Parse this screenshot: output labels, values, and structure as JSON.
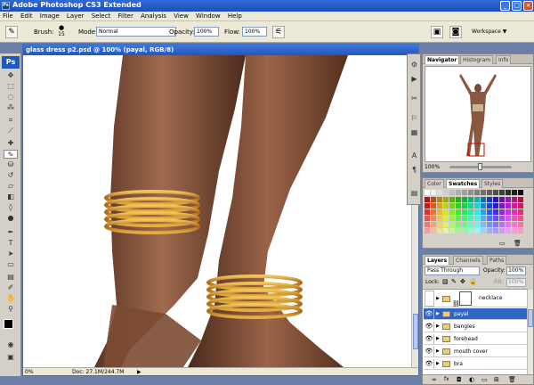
{
  "app": {
    "title": "Adobe Photoshop CS3 Extended",
    "logo": "Ps",
    "window_min": "_",
    "window_max": "□",
    "window_close": "×"
  },
  "menu": [
    "File",
    "Edit",
    "Image",
    "Layer",
    "Select",
    "Filter",
    "Analysis",
    "View",
    "Window",
    "Help"
  ],
  "options": {
    "brush_label": "Brush:",
    "brush_size": "15",
    "mode_label": "Mode:",
    "mode_value": "Normal",
    "opacity_label": "Opacity:",
    "opacity_value": "100%",
    "flow_label": "Flow:",
    "flow_value": "100%",
    "workspace_label": "Workspace ▼"
  },
  "document": {
    "title": "glass dress p2.psd @ 100% (payal, RGB/8)",
    "zoom": "0%",
    "doc_info": "Doc: 27.1M/244.7M"
  },
  "navigator": {
    "tabs": [
      "Navigator",
      "Histogram",
      "Info"
    ],
    "zoom": "100%"
  },
  "swatches": {
    "tabs": [
      "Color",
      "Swatches",
      "Styles"
    ]
  },
  "layers": {
    "tabs": [
      "Layers",
      "Channels",
      "Paths"
    ],
    "blend_mode": "Pass Through",
    "opacity_label": "Opacity:",
    "opacity_value": "100%",
    "lock_label": "Lock:",
    "fill_label": "Fill:",
    "fill_value": "100%",
    "items": [
      {
        "name": "necklace",
        "selected": false
      },
      {
        "name": "payal",
        "selected": true
      },
      {
        "name": "bangles",
        "selected": false
      },
      {
        "name": "forehead",
        "selected": false
      },
      {
        "name": "mouth cover",
        "selected": false
      },
      {
        "name": "bra",
        "selected": false
      }
    ],
    "footer_icons": [
      "∞",
      "fx",
      "◘",
      "◐",
      "▭",
      "⊞",
      "🗑"
    ]
  },
  "colors": {
    "title_blue": "#1d4fb8",
    "selection_blue": "#3165c4",
    "skin": "#7a4a35",
    "gold": "#c98a1e"
  }
}
